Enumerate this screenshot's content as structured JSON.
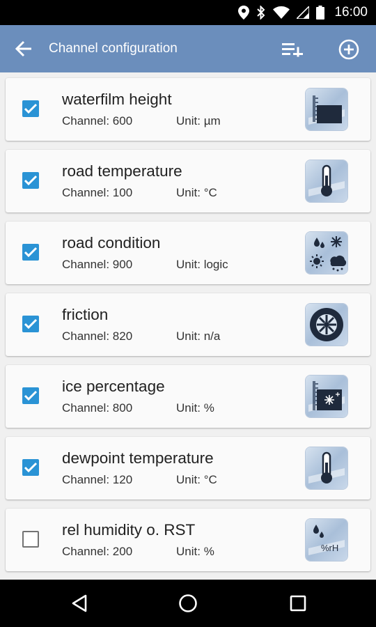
{
  "status_bar": {
    "time": "16:00",
    "icons": [
      "location-icon",
      "bluetooth-icon",
      "wifi-icon",
      "signal-icon",
      "battery-icon"
    ]
  },
  "app_bar": {
    "title": "Channel configuration",
    "color": "#6b8ebc",
    "actions": [
      "back-arrow-icon",
      "add-to-list-icon",
      "add-circle-icon"
    ]
  },
  "channel_prefix": "Channel:",
  "unit_prefix": "Unit:",
  "channels": [
    {
      "name": "waterfilm height",
      "channel": "600",
      "unit": "µm",
      "checked": true,
      "icon": "waterfilm-height-icon"
    },
    {
      "name": "road temperature",
      "channel": "100",
      "unit": "°C",
      "checked": true,
      "icon": "thermometer-icon"
    },
    {
      "name": "road condition",
      "channel": "900",
      "unit": "logic",
      "checked": true,
      "icon": "weather-condition-icon"
    },
    {
      "name": "friction",
      "channel": "820",
      "unit": "n/a",
      "checked": true,
      "icon": "tire-icon"
    },
    {
      "name": "ice percentage",
      "channel": "800",
      "unit": "%",
      "checked": true,
      "icon": "ice-percentage-icon"
    },
    {
      "name": "dewpoint temperature",
      "channel": "120",
      "unit": "°C",
      "checked": true,
      "icon": "thermometer-icon"
    },
    {
      "name": "rel humidity o. RST",
      "channel": "200",
      "unit": "%",
      "checked": false,
      "icon": "humidity-icon"
    }
  ],
  "nav_bar": [
    "back-triangle-icon",
    "home-circle-icon",
    "recents-square-icon"
  ],
  "accent_color": "#2a93d5"
}
